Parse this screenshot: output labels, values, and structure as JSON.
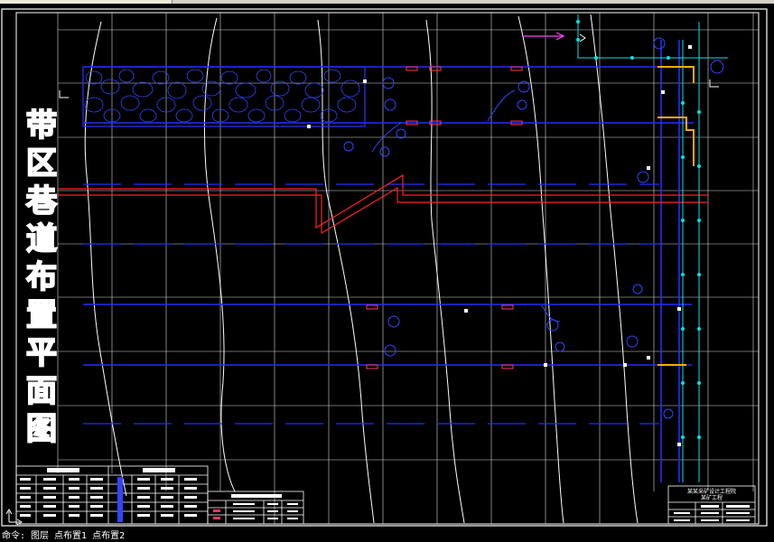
{
  "drawing": {
    "vertical_title": [
      "带",
      "区",
      "巷",
      "道",
      "布",
      "置",
      "平",
      "面",
      "图"
    ],
    "title_block": {
      "organization": "某某采矿设计工程院",
      "project": "某矿工程"
    }
  },
  "command_line": {
    "text": "命令: 图层 点布置1 点布置2"
  },
  "colors": {
    "background": "#000000",
    "frame": "#ffffff",
    "roadway": "#0000ff",
    "fault": "#ff0000",
    "pipeline": "#00ffff",
    "highlight": "#ffaa00",
    "magenta": "#ff00ff"
  }
}
